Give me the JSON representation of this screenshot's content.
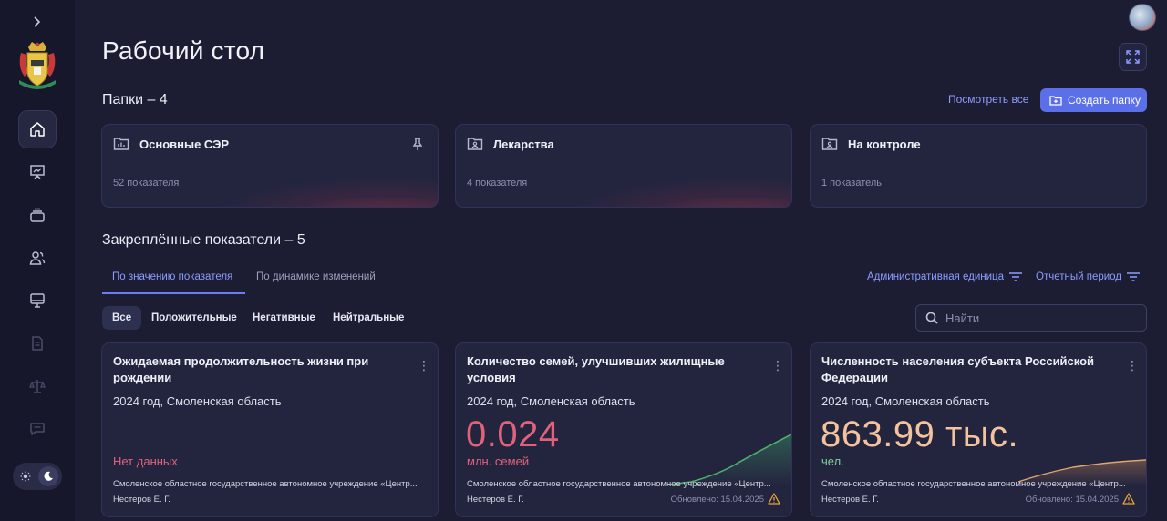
{
  "colors": {
    "accent": "#5b6fe9",
    "link": "#8e9cff",
    "negative": "#e0627a",
    "value_pink": "#e0627a",
    "value_orange": "#f2c39c",
    "unit_green": "#7fce9a",
    "positive_trend": "#4caf6e"
  },
  "sidebar": {
    "items": [
      {
        "icon": "home-icon",
        "active": true
      },
      {
        "icon": "presentation-chart-icon",
        "active": false
      },
      {
        "icon": "stack-icon",
        "active": false
      },
      {
        "icon": "users-icon",
        "active": false
      },
      {
        "icon": "monitor-icon",
        "active": false
      },
      {
        "icon": "document-icon",
        "active": false
      },
      {
        "icon": "scales-icon",
        "active": false
      },
      {
        "icon": "chat-icon",
        "active": false
      }
    ]
  },
  "header": {
    "title": "Рабочий стол"
  },
  "folders": {
    "title": "Папки – 4",
    "view_all": "Посмотреть все",
    "create_label": "Создать папку",
    "items": [
      {
        "name": "Основные СЭР",
        "count": "52 показателя",
        "pinned": true
      },
      {
        "name": "Лекарства",
        "count": "4 показателя",
        "pinned": false
      },
      {
        "name": "На контроле",
        "count": "1 показатель",
        "pinned": false
      }
    ]
  },
  "pinned": {
    "title": "Закреплённые показатели – 5",
    "tabs": [
      "По значению показателя",
      "По динамике изменений"
    ],
    "filters": [
      "Административная единица",
      "Отчетный период"
    ],
    "chips": [
      "Все",
      "Положительные",
      "Негативные",
      "Нейтральные"
    ],
    "search_placeholder": "Найти",
    "cards": [
      {
        "title": "Ожидаемая продолжительность жизни при рождении",
        "subtitle": "2024 год, Смоленская область",
        "value": "",
        "unit": "",
        "nodata": "Нет данных",
        "org": "Смоленское областное государственное автономное учреждение «Центр...",
        "author": "Нестеров Е. Г.",
        "updated": ""
      },
      {
        "title": "Количество семей, улучшивших жилищные условия",
        "subtitle": "2024 год, Смоленская область",
        "value": "0.024",
        "unit": "млн. семей",
        "nodata": "",
        "org": "Смоленское областное государственное автономное учреждение «Центр...",
        "author": "Нестеров Е. Г.",
        "updated": "Обновлено: 15.04.2025"
      },
      {
        "title": "Численность населения субъекта Российской Федерации",
        "subtitle": "2024 год, Смоленская область",
        "value": "863.99 тыс.",
        "unit": "чел.",
        "nodata": "",
        "org": "Смоленское областное государственное автономное учреждение «Центр...",
        "author": "Нестеров Е. Г.",
        "updated": "Обновлено: 15.04.2025"
      }
    ]
  }
}
